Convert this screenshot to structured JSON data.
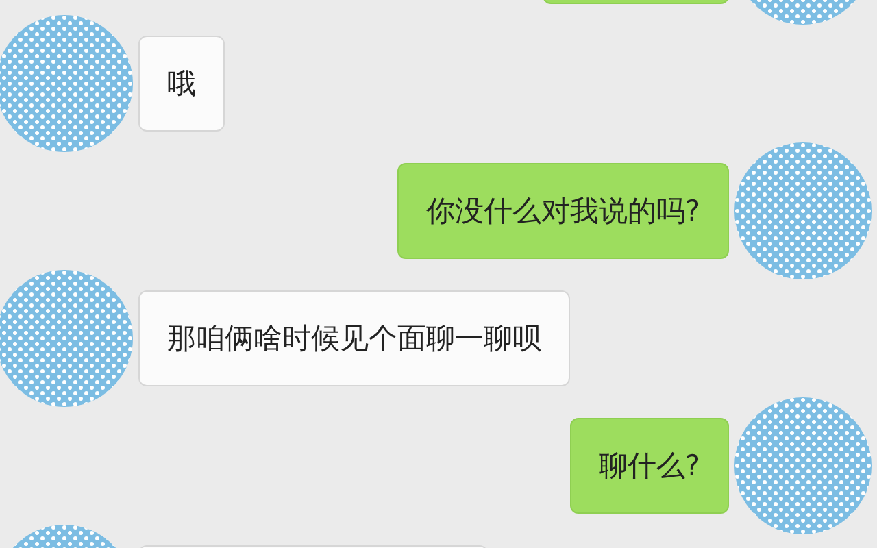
{
  "messages": [
    {
      "kind": "sent"
    },
    {
      "kind": "received",
      "text": "哦"
    },
    {
      "kind": "sent",
      "text": "你没什么对我说的吗?"
    },
    {
      "kind": "received",
      "text": "那咱俩啥时候见个面聊一聊呗"
    },
    {
      "kind": "sent",
      "text": "聊什么?"
    },
    {
      "kind": "received"
    }
  ]
}
